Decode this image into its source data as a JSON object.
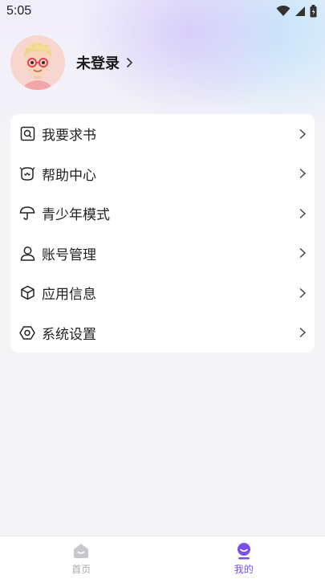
{
  "status_bar": {
    "time": "5:05",
    "icons": [
      "wifi-icon",
      "signal-icon",
      "battery-icon"
    ]
  },
  "profile": {
    "login_label": "未登录",
    "avatar": "cartoon-avatar"
  },
  "menu": {
    "items": [
      {
        "label": "我要求书",
        "icon": "book-search-icon"
      },
      {
        "label": "帮助中心",
        "icon": "help-bot-icon"
      },
      {
        "label": "青少年模式",
        "icon": "umbrella-icon"
      },
      {
        "label": "账号管理",
        "icon": "user-icon"
      },
      {
        "label": "应用信息",
        "icon": "box-icon"
      },
      {
        "label": "系统设置",
        "icon": "settings-icon"
      }
    ]
  },
  "bottom_nav": {
    "tabs": [
      {
        "label": "首页",
        "icon": "home-icon",
        "active": false
      },
      {
        "label": "我的",
        "icon": "profile-icon",
        "active": true
      }
    ]
  },
  "colors": {
    "accent": "#7a4ff0",
    "inactive": "#aaaaaa"
  }
}
